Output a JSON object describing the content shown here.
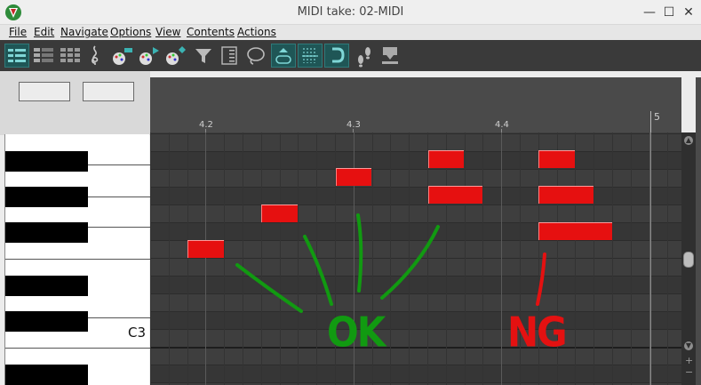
{
  "window": {
    "title": "MIDI take: 02-MIDI",
    "controls": {
      "minimize": "—",
      "maximize": "☐",
      "close": "✕"
    }
  },
  "menu": [
    "File",
    "Edit",
    "Navigate",
    "Options",
    "View",
    "Contents",
    "Actions"
  ],
  "toolbar": {
    "buttons": [
      {
        "name": "piano-roll-view-icon",
        "active": true
      },
      {
        "name": "named-notes-view-icon",
        "active": false
      },
      {
        "name": "drum-grid-view-icon",
        "active": false
      },
      {
        "name": "notation-clef-icon",
        "active": false
      },
      {
        "name": "color-notes-channel-icon",
        "active": false
      },
      {
        "name": "color-notes-track-icon",
        "active": false
      },
      {
        "name": "color-notes-velocity-icon",
        "active": false
      },
      {
        "name": "filter-icon",
        "active": false
      },
      {
        "name": "keyboard-track-icon",
        "active": false
      },
      {
        "name": "lasso-select-icon",
        "active": false
      },
      {
        "name": "loop-icon",
        "active": true
      },
      {
        "name": "grid-snap-icon",
        "active": true
      },
      {
        "name": "magnet-snap-icon",
        "active": true
      },
      {
        "name": "step-input-icon",
        "active": false
      },
      {
        "name": "midi-input-icon",
        "active": false
      }
    ]
  },
  "piano": {
    "octave_label": "C3"
  },
  "ruler": {
    "labels": [
      "4.2",
      "4.3",
      "4.4",
      "5"
    ]
  },
  "notes": [
    {
      "group": "OK",
      "pitch_row": 6
    },
    {
      "group": "OK",
      "pitch_row": 4
    },
    {
      "group": "OK",
      "pitch_row": 2
    },
    {
      "group": "OK",
      "pitch_row": 1
    },
    {
      "group": "OK",
      "pitch_row": 3
    },
    {
      "group": "NG",
      "pitch_row": 1
    },
    {
      "group": "NG",
      "pitch_row": 3
    },
    {
      "group": "NG",
      "pitch_row": 5
    }
  ],
  "annotations": {
    "ok": "OK",
    "ng": "NG",
    "ok_color": "#119a11",
    "ng_color": "#e41111"
  },
  "colors": {
    "note_fill": "#e61010",
    "toolbar_bg": "#3a3a3a",
    "toolbar_active": "#1f5656"
  }
}
